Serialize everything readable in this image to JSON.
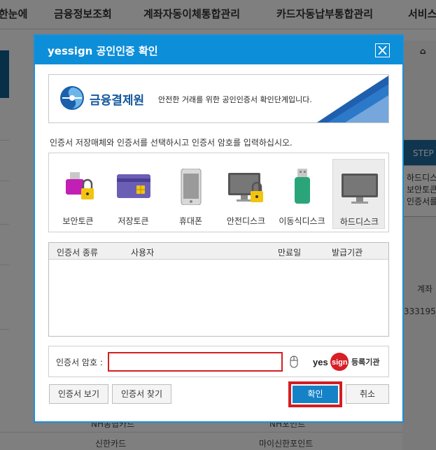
{
  "background": {
    "nav_items": [
      "한눈에",
      "금융정보조회",
      "계좌자동이체통합관리",
      "카드자동납부통합관리",
      "서비스"
    ],
    "home_icon": "home-icon",
    "step_label": "STEP",
    "right_col_label": "계좌",
    "right_col_value": "333195",
    "row_left_1": "NH농협카드",
    "row_right_1": "NH포인트",
    "row_left_2": "신한카드",
    "row_right_2": "마이신한포인트",
    "tooltip_lines": [
      "하드디스",
      "보안토큰",
      "인증서를"
    ]
  },
  "dialog": {
    "title": "yessign 공인인증 확인",
    "close_icon": "close-icon",
    "banner": {
      "org_name": "금융결제원",
      "subtitle": "안전한 거래를 위한 공인인증서 확인단계입니다."
    },
    "instruction": "인증서 저장매체와 인증서를 선택하시고 인증서 암호를 입력하십시오.",
    "media": [
      {
        "label": "보안토큰",
        "icon": "usb-lock-icon"
      },
      {
        "label": "저장토큰",
        "icon": "smart-card-icon"
      },
      {
        "label": "휴대폰",
        "icon": "phone-icon"
      },
      {
        "label": "안전디스크",
        "icon": "monitor-lock-icon"
      },
      {
        "label": "이동식디스크",
        "icon": "usb-drive-icon"
      },
      {
        "label": "하드디스크",
        "icon": "monitor-icon"
      }
    ],
    "cert_table": {
      "columns": [
        "인증서 종류",
        "사용자",
        "만료일",
        "발급기관"
      ]
    },
    "password": {
      "label": "인증서 암호 :",
      "value": "",
      "mouse_icon": "mouse-icon"
    },
    "yessign_logo_text": "yessign",
    "registration_label": "등록기관",
    "buttons": {
      "view": "인증서 보기",
      "find": "인증서 찾기",
      "ok": "확인",
      "cancel": "취소"
    },
    "colors": {
      "title_bar": "#0d8ed9",
      "ok_button": "#1582c7",
      "highlight_border": "#d21e23"
    }
  }
}
